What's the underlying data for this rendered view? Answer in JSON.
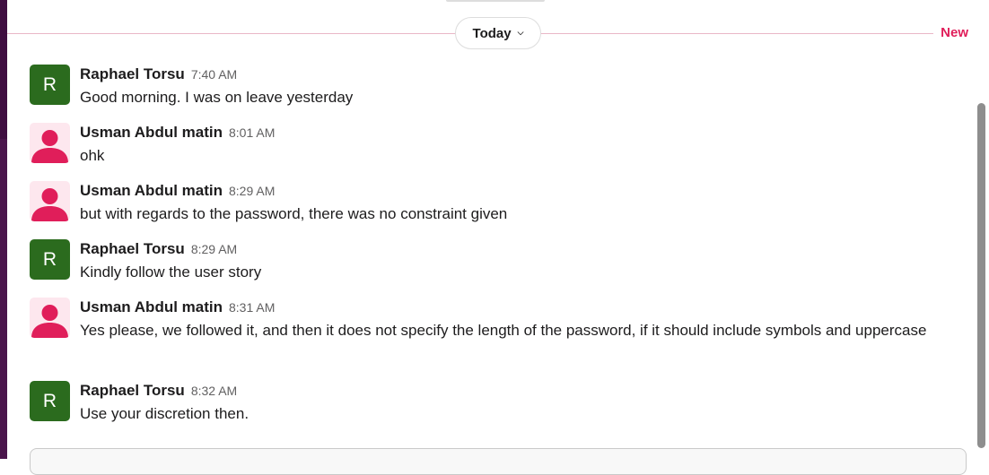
{
  "divider": {
    "day_label": "Today",
    "new_label": "New"
  },
  "colors": {
    "accent_new": "#e01e5a",
    "avatar_green": "#2b6b1e",
    "avatar_user_fg": "#e01e5a",
    "avatar_user_bg": "#fde7ee"
  },
  "messages": [
    {
      "sender": "Raphael Torsu",
      "time": "7:40 AM",
      "avatar": "R",
      "text": "Good morning. I was on leave yesterday"
    },
    {
      "sender": "Usman Abdul matin",
      "time": "8:01 AM",
      "avatar_icon": "default-user-icon",
      "text": "ohk"
    },
    {
      "sender": "Usman Abdul matin",
      "time": "8:29 AM",
      "avatar_icon": "default-user-icon",
      "text": "but with regards to the password, there was no constraint given"
    },
    {
      "sender": "Raphael Torsu",
      "time": "8:29 AM",
      "avatar": "R",
      "text": "Kindly follow the user story"
    },
    {
      "sender": "Usman Abdul matin",
      "time": "8:31 AM",
      "avatar_icon": "default-user-icon",
      "text": "Yes please, we followed it, and then it does not specify the length of the password, if it should include symbols and uppercase"
    },
    {
      "sender": "Raphael Torsu",
      "time": "8:32 AM",
      "avatar": "R",
      "text": "Use your discretion then."
    }
  ]
}
